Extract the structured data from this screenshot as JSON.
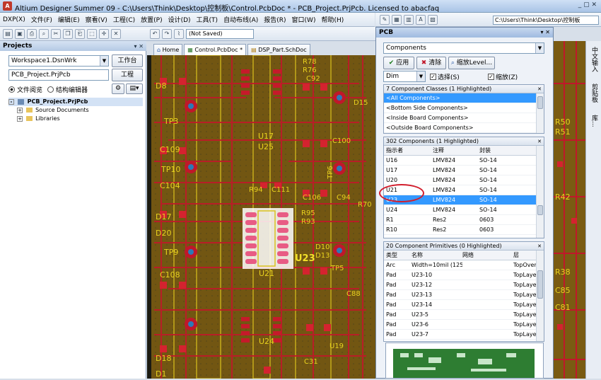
{
  "window": {
    "title": "Altium Designer Summer 09 - C:\\Users\\Think\\Desktop\\控制板\\Control.PcbDoc * - PCB_Project.PrjPcb. Licensed to abacfaq"
  },
  "menu": [
    "DXP(X)",
    "文件(F)",
    "编辑(E)",
    "察看(V)",
    "工程(C)",
    "放置(P)",
    "设计(D)",
    "工具(T)",
    "自动布线(A)",
    "报告(R)",
    "窗口(W)",
    "帮助(H)"
  ],
  "toolbar": {
    "status": "(Not Saved)",
    "path": "C:\\Users\\Think\\Desktop\\控制板"
  },
  "projects_panel": {
    "title": "Projects",
    "workspace": "Workspace1.DsnWrk",
    "workspace_button": "工作台",
    "project": "PCB_Project.PrjPcb",
    "project_button": "工程",
    "view_file": "文件阅览",
    "view_struct": "结构编辑器",
    "tree": [
      {
        "label": "PCB_Project.PrjPcb"
      },
      {
        "label": "Source Documents"
      },
      {
        "label": "Libraries"
      }
    ]
  },
  "doc_tabs": [
    "Home",
    "Control.PcbDoc *",
    "DSP_Part.SchDoc"
  ],
  "pcb_panel": {
    "title": "PCB",
    "mode": "Components",
    "apply": "应用",
    "clear": "清除",
    "zoom_level": "缩放Level...",
    "dim": "Dim",
    "select_label": "选择(S)",
    "zoom_label": "缩放(Z)",
    "classes_title": "7 Component Classes (1 Highlighted)",
    "classes": [
      "<All Components>",
      "<Bottom Side Components>",
      "<Inside Board Components>",
      "<Outside Board Components>"
    ],
    "components_title": "302 Components (1 Highlighted)",
    "component_headers": [
      "指示者",
      "注释",
      "封装"
    ],
    "components": [
      {
        "ref": "U16",
        "comment": "LMV824",
        "footprint": "SO-14"
      },
      {
        "ref": "U17",
        "comment": "LMV824",
        "footprint": "SO-14"
      },
      {
        "ref": "U20",
        "comment": "LMV824",
        "footprint": "SO-14"
      },
      {
        "ref": "U21",
        "comment": "LMV824",
        "footprint": "SO-14"
      },
      {
        "ref": "U23",
        "comment": "LMV824",
        "footprint": "SO-14"
      },
      {
        "ref": "U24",
        "comment": "LMV824",
        "footprint": "SO-14"
      },
      {
        "ref": "R1",
        "comment": "Res2",
        "footprint": "0603"
      },
      {
        "ref": "R10",
        "comment": "Res2",
        "footprint": "0603"
      }
    ],
    "primitives_title": "20 Component Primitives (0 Highlighted)",
    "primitive_headers": [
      "类型",
      "名称",
      "网络",
      "层"
    ],
    "primitives": [
      {
        "type": "Arc",
        "name": "Width=10mil (125",
        "net": "",
        "layer": "TopOver"
      },
      {
        "type": "Pad",
        "name": "U23-10",
        "net": "",
        "layer": "TopLaye"
      },
      {
        "type": "Pad",
        "name": "U23-12",
        "net": "",
        "layer": "TopLaye"
      },
      {
        "type": "Pad",
        "name": "U23-13",
        "net": "",
        "layer": "TopLaye"
      },
      {
        "type": "Pad",
        "name": "U23-14",
        "net": "",
        "layer": "TopLaye"
      },
      {
        "type": "Pad",
        "name": "U23-5",
        "net": "",
        "layer": "TopLaye"
      },
      {
        "type": "Pad",
        "name": "U23-6",
        "net": "",
        "layer": "TopLaye"
      },
      {
        "type": "Pad",
        "name": "U23-7",
        "net": "",
        "layer": "TopLaye"
      }
    ]
  },
  "pcb_labels": {
    "left": [
      "D8",
      "TP3",
      "C109",
      "TP10",
      "C104",
      "D17",
      "D20",
      "TP9",
      "C108",
      "D18",
      "D1"
    ],
    "center": [
      "U17",
      "U25",
      "R94",
      "C111",
      "U23",
      "U21",
      "U24",
      "R78",
      "R76",
      "C92",
      "D15",
      "C100",
      "C106",
      "R95",
      "R93",
      "D10",
      "D13",
      "TP5",
      "C88",
      "U19",
      "C31",
      "TP6",
      "C94",
      "R70"
    ],
    "right": [
      "R50",
      "R51",
      "R42",
      "R38",
      "C85",
      "C81"
    ]
  },
  "side_tabs": [
    "中文输入",
    "剪贴板",
    "库..."
  ]
}
